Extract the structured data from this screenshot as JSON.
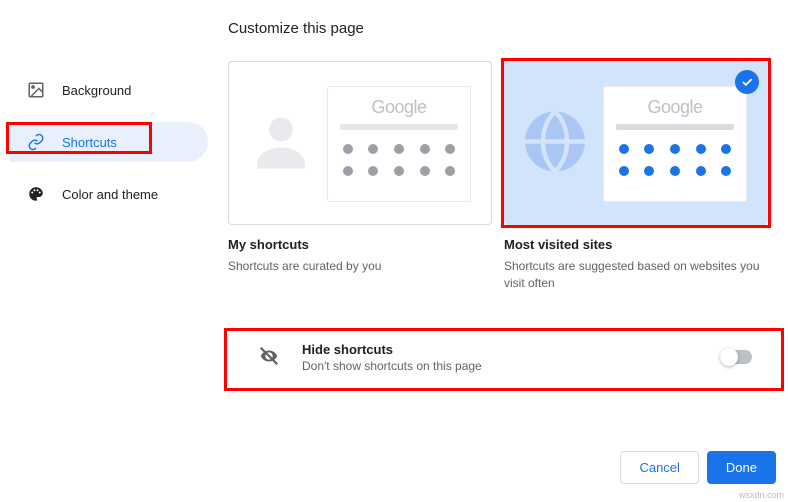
{
  "title": "Customize this page",
  "sidebar": {
    "items": [
      {
        "label": "Background"
      },
      {
        "label": "Shortcuts"
      },
      {
        "label": "Color and theme"
      }
    ],
    "selected_index": 1
  },
  "options": {
    "logo_text": "Google",
    "my_shortcuts": {
      "title": "My shortcuts",
      "desc": "Shortcuts are curated by you",
      "selected": false
    },
    "most_visited": {
      "title": "Most visited sites",
      "desc": "Shortcuts are suggested based on websites you visit often",
      "selected": true
    }
  },
  "hide": {
    "title": "Hide shortcuts",
    "desc": "Don't show shortcuts on this page",
    "enabled": false
  },
  "buttons": {
    "cancel": "Cancel",
    "done": "Done"
  },
  "watermark": "wsxdn.com"
}
